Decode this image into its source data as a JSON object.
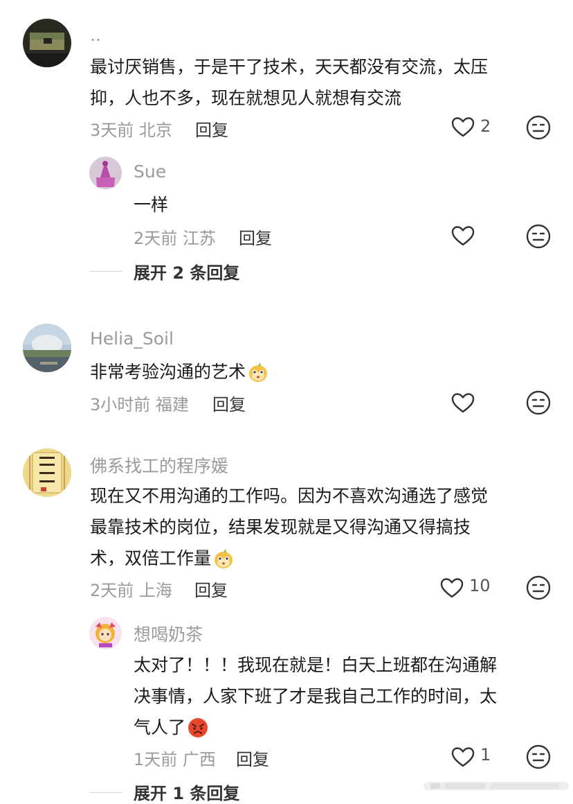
{
  "comments": [
    {
      "name": "..",
      "text": [
        "最讨厌销售，于是干了技术，天天都没有交流，太压",
        "抑，人也不多，现在就想见人就想有交流"
      ],
      "meta": "3天前 北京",
      "reply_label": "回复",
      "likes": "2",
      "replies": [
        {
          "name": "Sue",
          "text": [
            "一样"
          ],
          "meta": "2天前 江苏",
          "reply_label": "回复",
          "likes": ""
        }
      ],
      "expand": "展开 2 条回复"
    },
    {
      "name": "Helia_Soil",
      "text": [
        "非常考验沟通的艺术"
      ],
      "meta": "3小时前 福建",
      "reply_label": "回复",
      "likes": ""
    },
    {
      "name": "佛系找工的程序媛",
      "text": [
        "现在又不用沟通的工作吗。因为不喜欢沟通选了感觉",
        "最靠技术的岗位，结果发现就是又得沟通又得搞技",
        "术，双倍工作量"
      ],
      "meta": "2天前 上海",
      "reply_label": "回复",
      "likes": "10",
      "replies": [
        {
          "name": "想喝奶茶",
          "text": [
            "太对了！！！我现在就是！白天上班都在沟通解",
            "决事情，人家下班了才是我自己工作的时间，太",
            "气人了"
          ],
          "meta": "1天前 广西",
          "reply_label": "回复",
          "likes": "1"
        }
      ],
      "expand": "展开 1 条回复"
    }
  ],
  "icons": {
    "like": "heart-outline-icon",
    "dislike": "meh-face-icon",
    "emoji_dog": "dog-sticker-emoji",
    "emoji_angry": "angry-face-emoji"
  },
  "colors": {
    "meta": "#9a9a9a",
    "text": "#1a1a1a",
    "angry": "#e5482a"
  }
}
